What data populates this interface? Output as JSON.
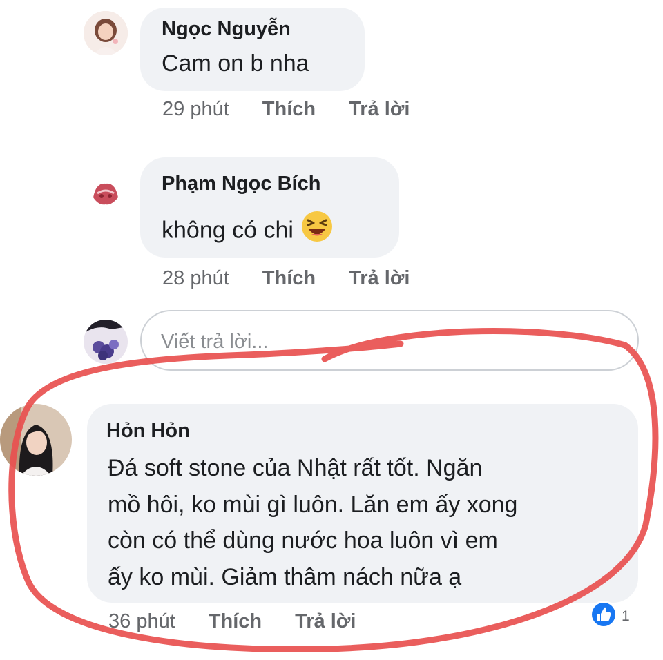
{
  "comments": [
    {
      "author": "Ngọc Nguyễn",
      "text": "Cam on b nha",
      "time": "29 phút",
      "like_label": "Thích",
      "reply_label": "Trả lời"
    },
    {
      "author": "Phạm Ngọc Bích",
      "text": "không có chi",
      "time": "28 phút",
      "like_label": "Thích",
      "reply_label": "Trả lời"
    },
    {
      "author": "Hỏn Hỏn",
      "text_lines": [
        "Đá soft stone của Nhật rất tốt. Ngăn",
        "mồ hôi, ko mùi gì luôn. Lăn em ấy xong",
        "còn có thể dùng nước hoa luôn vì em",
        "ấy ko mùi. Giảm thâm nách nữa ạ"
      ],
      "time": "36 phút",
      "like_label": "Thích",
      "reply_label": "Trả lời",
      "reaction_count": "1"
    }
  ],
  "reply_box": {
    "placeholder": "Viết trả lời..."
  },
  "colors": {
    "bubble": "#f0f2f5",
    "like_blue": "#1877f2",
    "annotation_red": "#e8504f"
  },
  "icons": {
    "emoji": "laughing-emoji-icon",
    "reaction": "like-reaction-icon"
  }
}
